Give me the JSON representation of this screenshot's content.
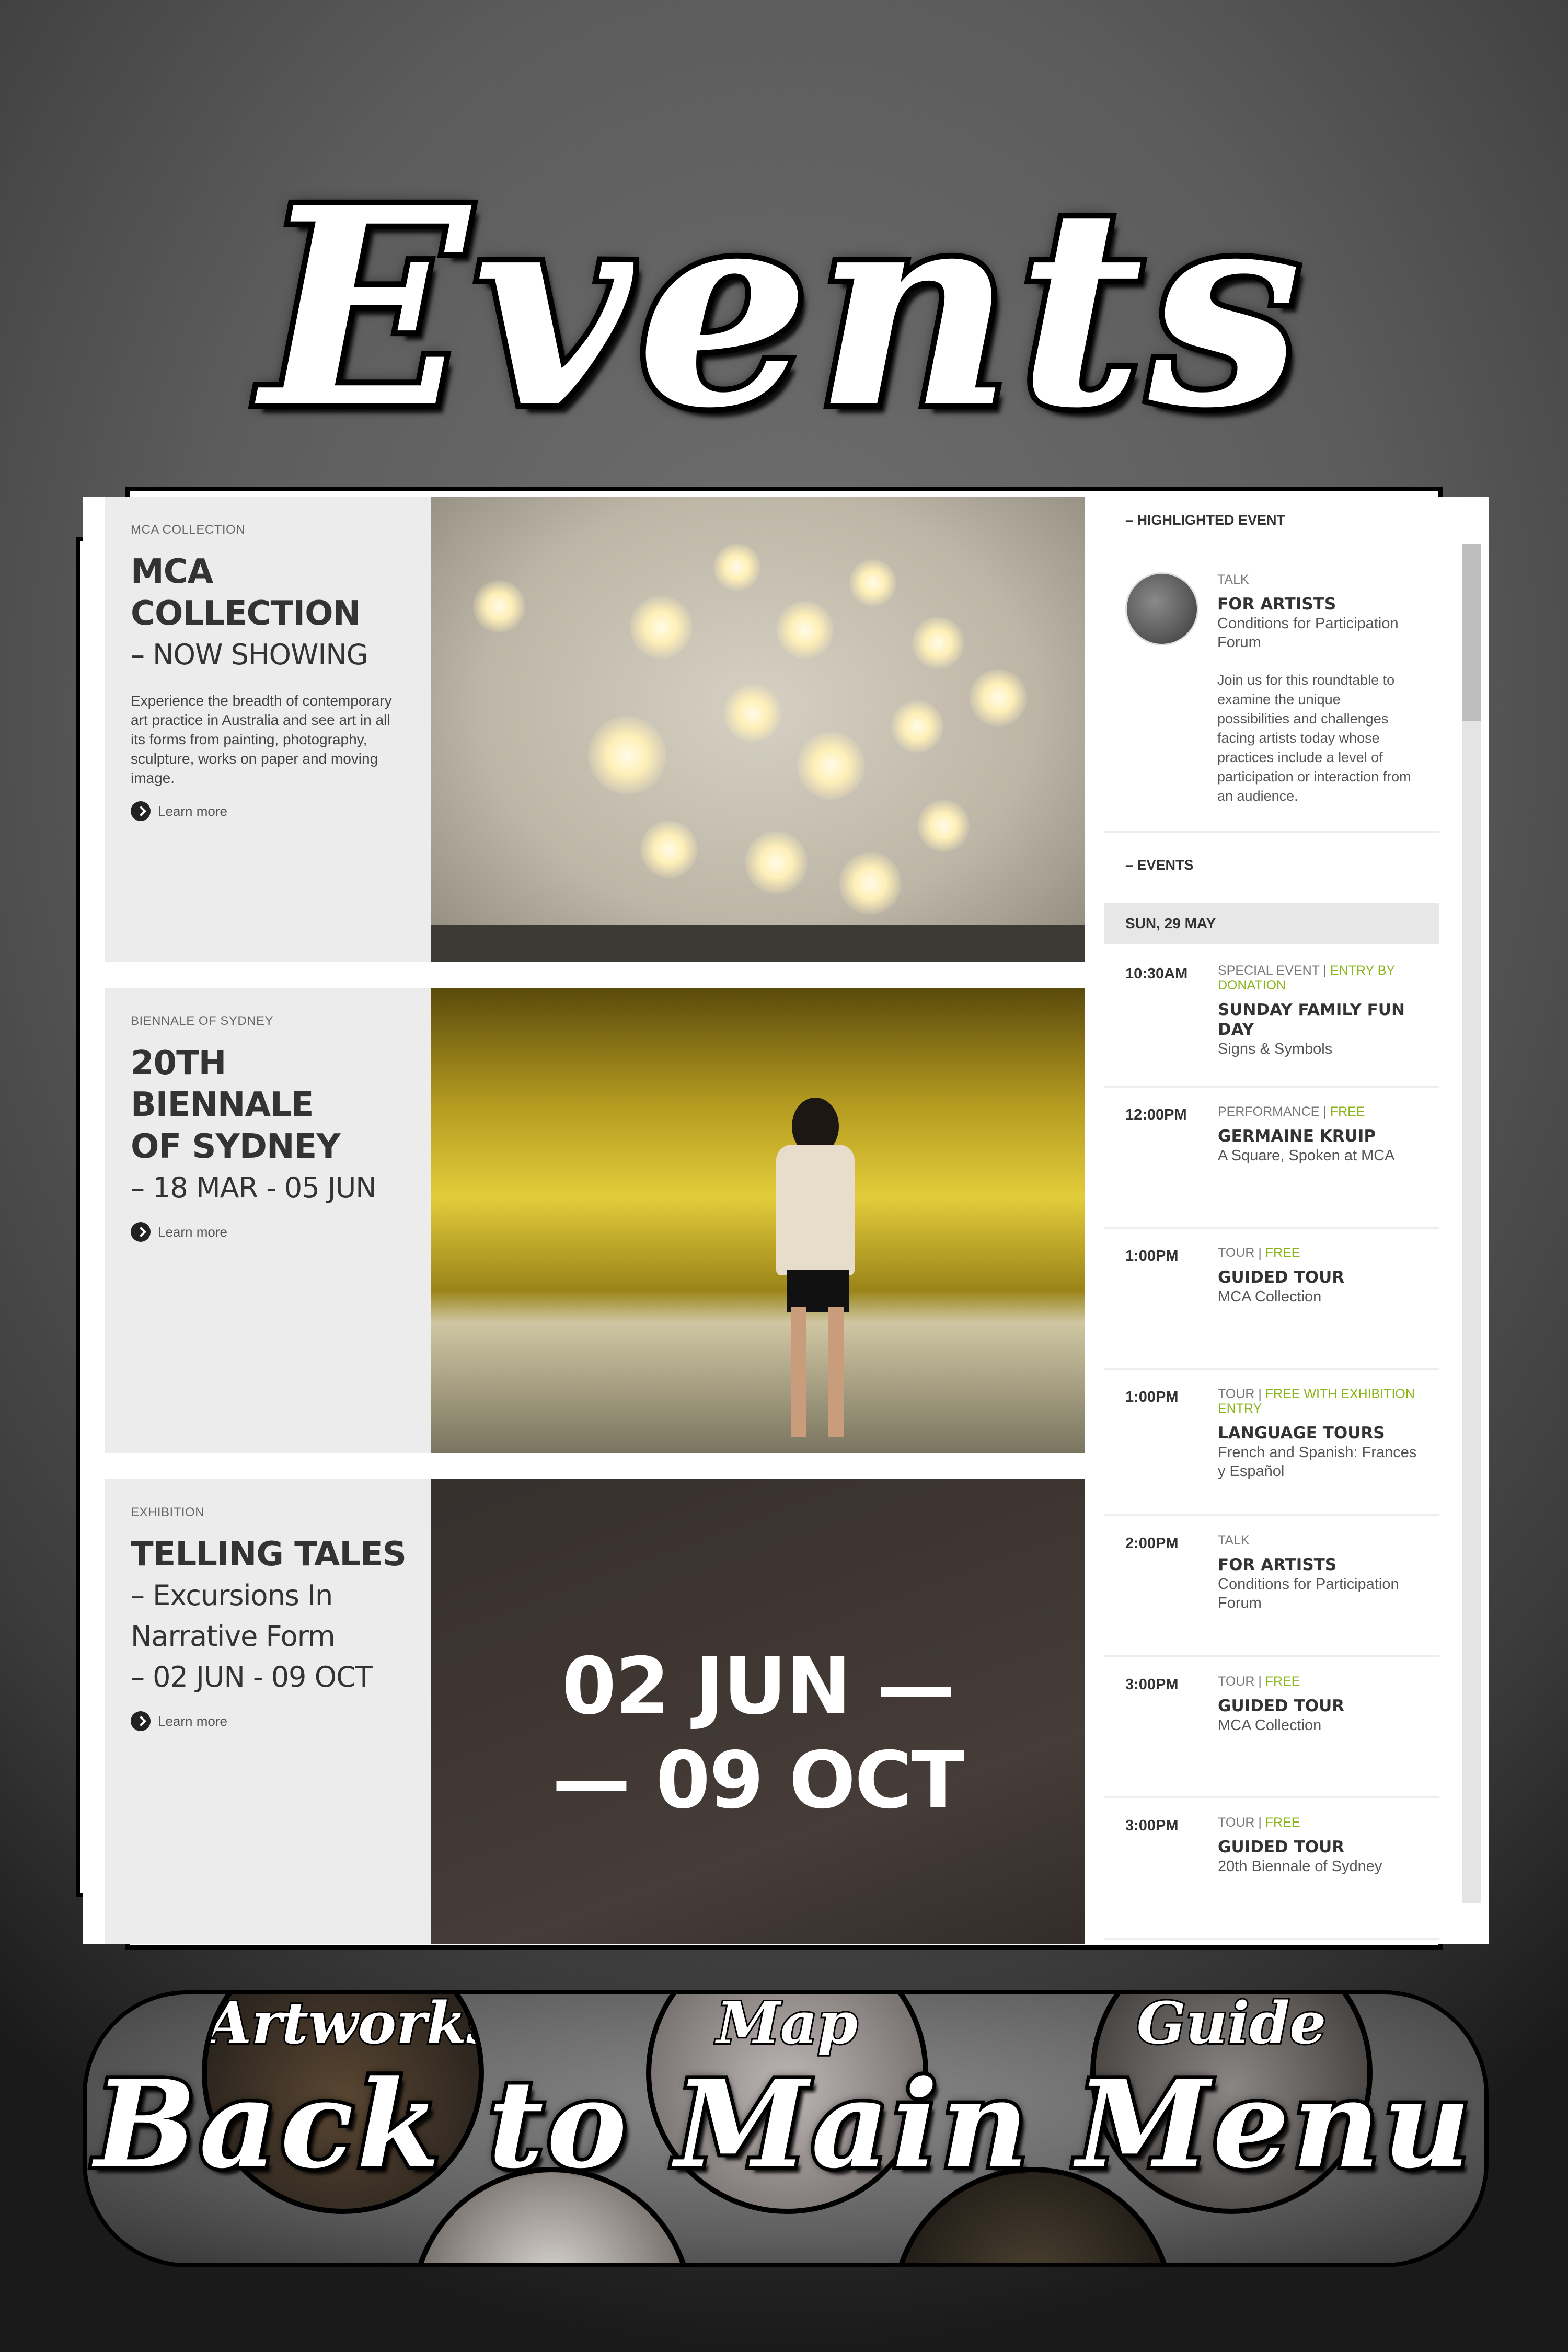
{
  "header": {
    "title": "Events"
  },
  "cards": [
    {
      "kicker": "MCA COLLECTION",
      "title_line1": "MCA",
      "title_line2": "COLLECTION",
      "subtitle": "– NOW SHOWING",
      "description": "Experience the breadth of contemporary art practice in Australia and see art in all its forms from painting, photography, sculpture, works on paper and moving image.",
      "learn_more": "Learn more"
    },
    {
      "kicker": "BIENNALE OF SYDNEY",
      "title_line1": "20TH BIENNALE",
      "title_line2": "OF SYDNEY",
      "subtitle": "– 18 MAR - 05 JUN",
      "learn_more": "Learn more"
    },
    {
      "kicker": "EXHIBITION",
      "title_line1": "TELLING TALES",
      "title_line2": "– Excursions In",
      "title_line3": "Narrative Form",
      "subtitle": "– 02 JUN - 09 OCT",
      "learn_more": "Learn more",
      "overlay_line1": "02 JUN —",
      "overlay_line2": "— 09 OCT"
    }
  ],
  "highlighted": {
    "heading": "– HIGHLIGHTED EVENT",
    "type": "TALK",
    "title": "FOR ARTISTS",
    "subtitle": "Conditions for Participation Forum",
    "description": "Join us for this roundtable to examine the unique possibilities and challenges facing artists today whose practices include a level of participation or interaction from an audience."
  },
  "events": {
    "heading": "– EVENTS",
    "date": "SUN, 29 MAY",
    "items": [
      {
        "time": "10:30AM",
        "type": "SPECIAL EVENT",
        "tag": "ENTRY BY DONATION",
        "title": "SUNDAY FAMILY FUN DAY",
        "subtitle": "Signs & Symbols"
      },
      {
        "time": "12:00PM",
        "type": "PERFORMANCE",
        "tag": "FREE",
        "title": "GERMAINE KRUIP",
        "subtitle": "A Square, Spoken at MCA"
      },
      {
        "time": "1:00PM",
        "type": "TOUR",
        "tag": "FREE",
        "title": "GUIDED TOUR",
        "subtitle": "MCA Collection"
      },
      {
        "time": "1:00PM",
        "type": "TOUR",
        "tag": "FREE WITH EXHIBITION ENTRY",
        "title": "LANGUAGE TOURS",
        "subtitle": "French and Spanish: Frances y Español"
      },
      {
        "time": "2:00PM",
        "type": "TALK",
        "tag": "",
        "title": "FOR ARTISTS",
        "subtitle": "Conditions for Participation Forum"
      },
      {
        "time": "3:00PM",
        "type": "TOUR",
        "tag": "FREE",
        "title": "GUIDED TOUR",
        "subtitle": "MCA Collection"
      },
      {
        "time": "3:00PM",
        "type": "TOUR",
        "tag": "FREE",
        "title": "GUIDED TOUR",
        "subtitle": "20th Biennale of Sydney"
      }
    ]
  },
  "menu": {
    "thumb_labels": [
      "Artworks",
      "Map",
      "Guide"
    ],
    "back_label": "Back to Main Menu"
  },
  "colors": {
    "accent_green": "#8bb31a",
    "text_dark": "#333333"
  }
}
